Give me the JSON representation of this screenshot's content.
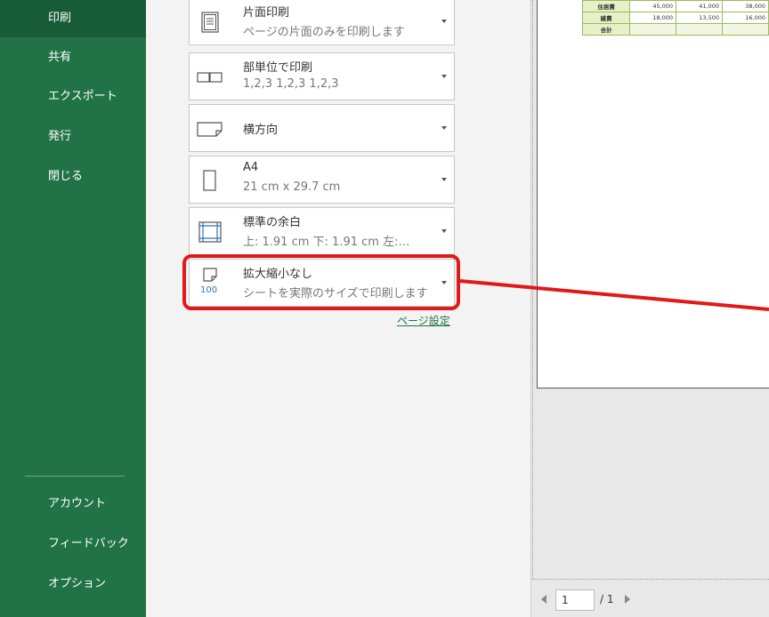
{
  "sidebar": {
    "items": [
      {
        "label": "印刷",
        "active": true
      },
      {
        "label": "共有"
      },
      {
        "label": "エクスポート"
      },
      {
        "label": "発行"
      },
      {
        "label": "閉じる"
      }
    ],
    "bottom_items": [
      {
        "label": "アカウント"
      },
      {
        "label": "フィードバック"
      },
      {
        "label": "オプション"
      }
    ]
  },
  "print_settings": [
    {
      "title": "片面印刷",
      "subtitle": "ページの片面のみを印刷します",
      "icon": "single-sided-icon"
    },
    {
      "title": "部単位で印刷",
      "subtitle": "1,2,3   1,2,3   1,2,3",
      "icon": "collate-icon"
    },
    {
      "title": "横方向",
      "subtitle": "",
      "icon": "landscape-icon"
    },
    {
      "title": "A4",
      "subtitle": "21 cm x 29.7 cm",
      "icon": "paper-size-icon"
    },
    {
      "title": "標準の余白",
      "subtitle": "上: 1.91 cm 下: 1.91 cm 左:…",
      "icon": "margins-icon"
    },
    {
      "title": "拡大縮小なし",
      "subtitle": "シートを実際のサイズで印刷します",
      "icon": "no-scaling-icon",
      "icon_text": "100"
    }
  ],
  "page_setup_link": "ページ設定",
  "preview": {
    "table_rows": [
      {
        "label": "住居費",
        "values": [
          "45,000",
          "41,000",
          "38,000"
        ]
      },
      {
        "label": "雑費",
        "values": [
          "18,000",
          "13,500",
          "16,000"
        ]
      },
      {
        "label": "合計",
        "values": [
          "",
          "",
          ""
        ]
      }
    ]
  },
  "pager": {
    "current": "1",
    "total": "/ 1"
  },
  "colors": {
    "sidebar": "#217346",
    "sidebar_active": "#185c37",
    "highlight": "#e0191a",
    "table_border": "#9bbb59"
  }
}
